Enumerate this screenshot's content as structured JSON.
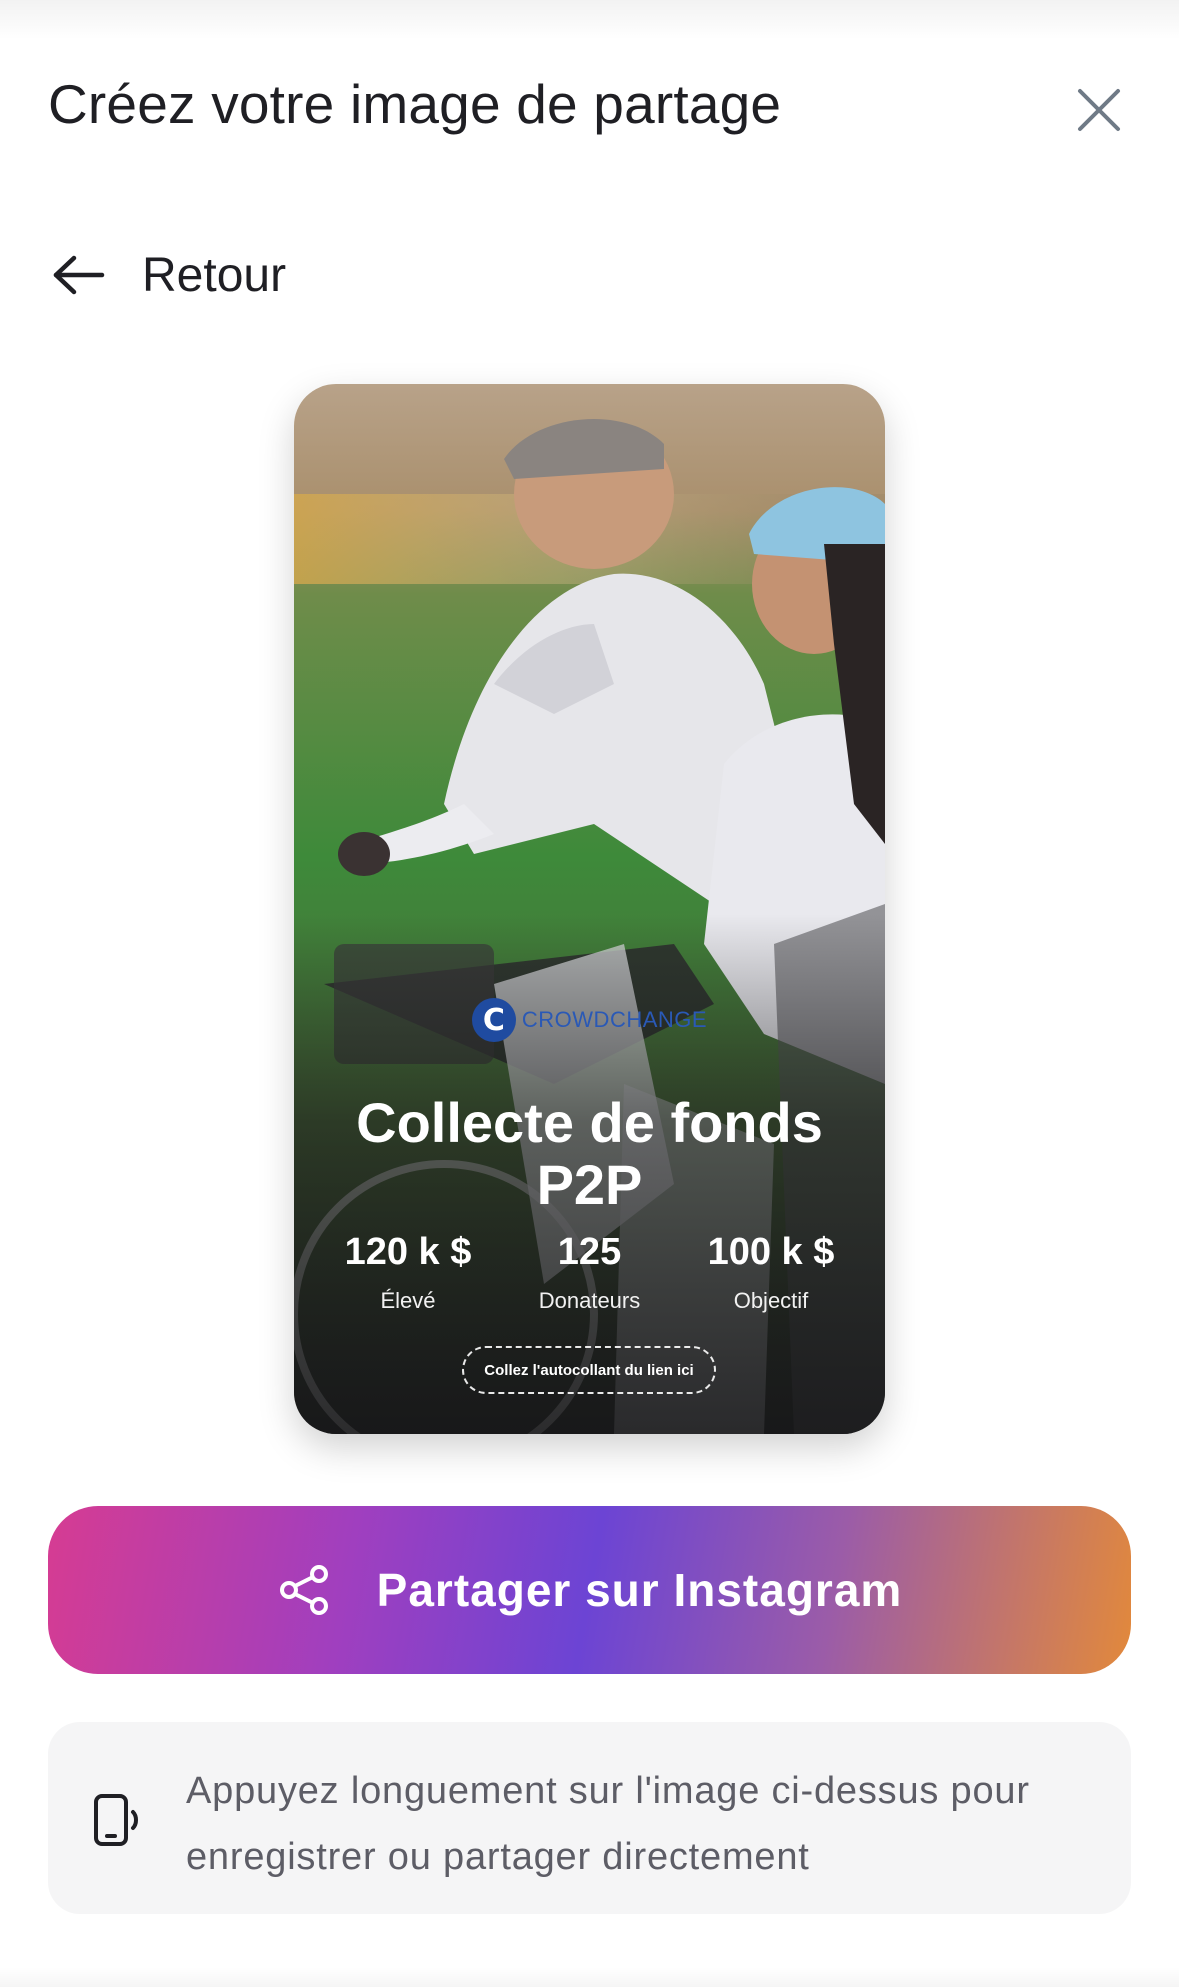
{
  "header": {
    "title": "Créez votre image de partage",
    "close_icon": "close-icon"
  },
  "back": {
    "label": "Retour",
    "icon": "arrow-left-icon"
  },
  "story": {
    "brand": "CROWDCHANGE",
    "brand_mark": "C",
    "title": "Collecte de fonds P2P",
    "stats": [
      {
        "value": "120 k $",
        "label": "Élevé"
      },
      {
        "value": "125",
        "label": "Donateurs"
      },
      {
        "value": "100 k $",
        "label": "Objectif"
      }
    ],
    "sticker_text": "Collez l'autocollant du lien ici"
  },
  "share_button": {
    "label": "Partager sur Instagram",
    "icon": "share-icon"
  },
  "tip": {
    "icon": "phone-icon",
    "text": "Appuyez longuement sur l'image ci-dessus pour enregistrer ou partager directement"
  },
  "colors": {
    "gradient_start": "#d63c92",
    "gradient_mid": "#6c44d4",
    "gradient_end": "#e2893b",
    "brand_blue": "#1f4ba0"
  }
}
